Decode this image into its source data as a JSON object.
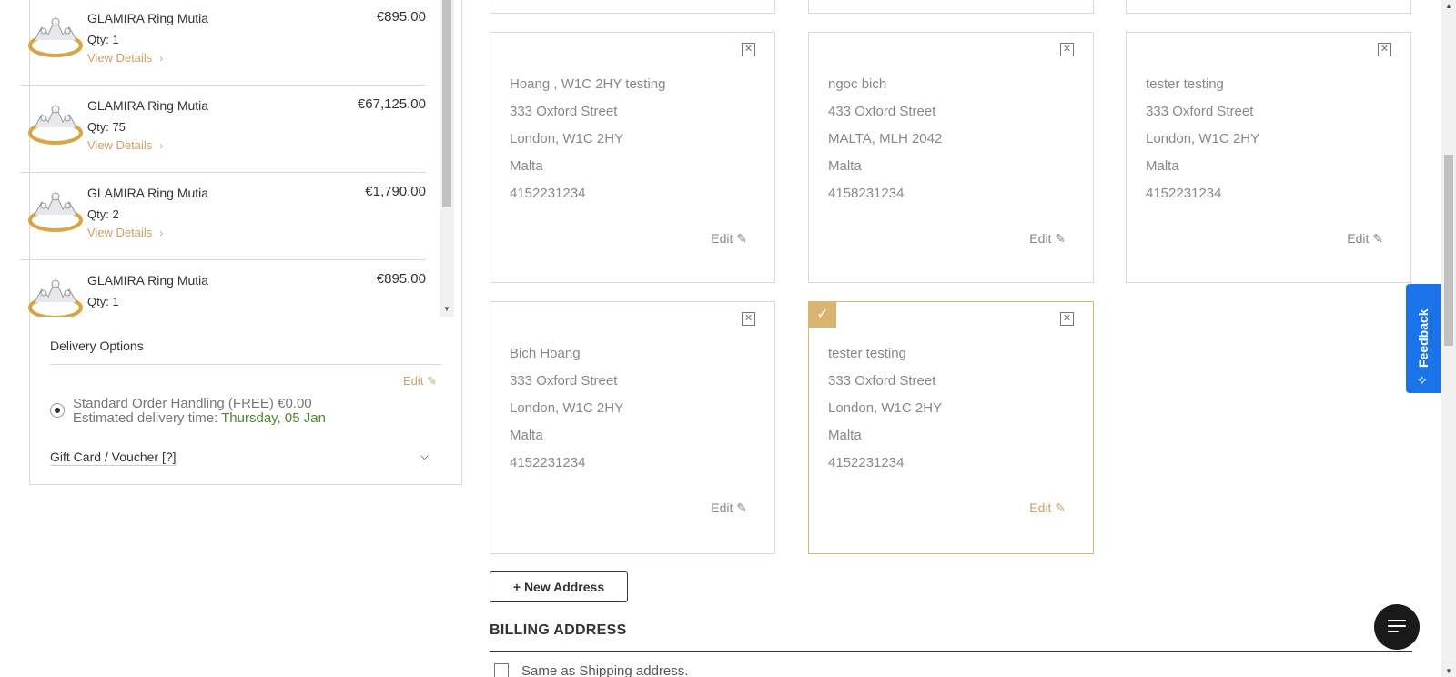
{
  "order_summary": {
    "items": [
      {
        "name": "GLAMIRA Ring Mutia",
        "qty": "Qty: 1",
        "price": "€895.00",
        "view_details": "View Details"
      },
      {
        "name": "GLAMIRA Ring Mutia",
        "qty": "Qty: 75",
        "price": "€67,125.00",
        "view_details": "View Details"
      },
      {
        "name": "GLAMIRA Ring Mutia",
        "qty": "Qty: 2",
        "price": "€1,790.00",
        "view_details": "View Details"
      },
      {
        "name": "GLAMIRA Ring Mutia",
        "qty": "Qty: 1",
        "price": "€895.00",
        "view_details": "View Details"
      }
    ],
    "delivery": {
      "title": "Delivery Options",
      "edit_label": "Edit",
      "option_text": "Standard Order Handling (FREE) €0.00",
      "estimated_label": "Estimated delivery time:",
      "estimated_date": "Thursday, 05 Jan"
    },
    "gift_card_label": "Gift Card / Voucher [?]"
  },
  "addresses": [
    {
      "lines": [
        "Hoang , W1C 2HY testing",
        "333 Oxford Street",
        "London, W1C 2HY",
        "Malta",
        "4152231234"
      ],
      "edit_label": "Edit",
      "selected": false
    },
    {
      "lines": [
        "ngoc bich",
        "433 Oxford Street",
        "MALTA, MLH 2042",
        "Malta",
        "4158231234"
      ],
      "edit_label": "Edit",
      "selected": false
    },
    {
      "lines": [
        "tester testing",
        "333 Oxford Street",
        "London, W1C 2HY",
        "Malta",
        "4152231234"
      ],
      "edit_label": "Edit",
      "selected": false
    },
    {
      "lines": [
        "Bich Hoang",
        "333 Oxford Street",
        "London, W1C 2HY",
        "Malta",
        "4152231234"
      ],
      "edit_label": "Edit",
      "selected": false
    },
    {
      "lines": [
        "tester testing",
        "333 Oxford Street",
        "London, W1C 2HY",
        "Malta",
        "4152231234"
      ],
      "edit_label": "Edit",
      "selected": true
    }
  ],
  "new_address_label": "+ New Address",
  "billing": {
    "title": "BILLING ADDRESS",
    "same_as_shipping": "Same as Shipping address."
  },
  "feedback_label": "Feedback",
  "colors": {
    "accent": "#d9b46f",
    "link": "#c8a06a",
    "feedback": "#1a73e8",
    "date": "#4a8a2a"
  }
}
